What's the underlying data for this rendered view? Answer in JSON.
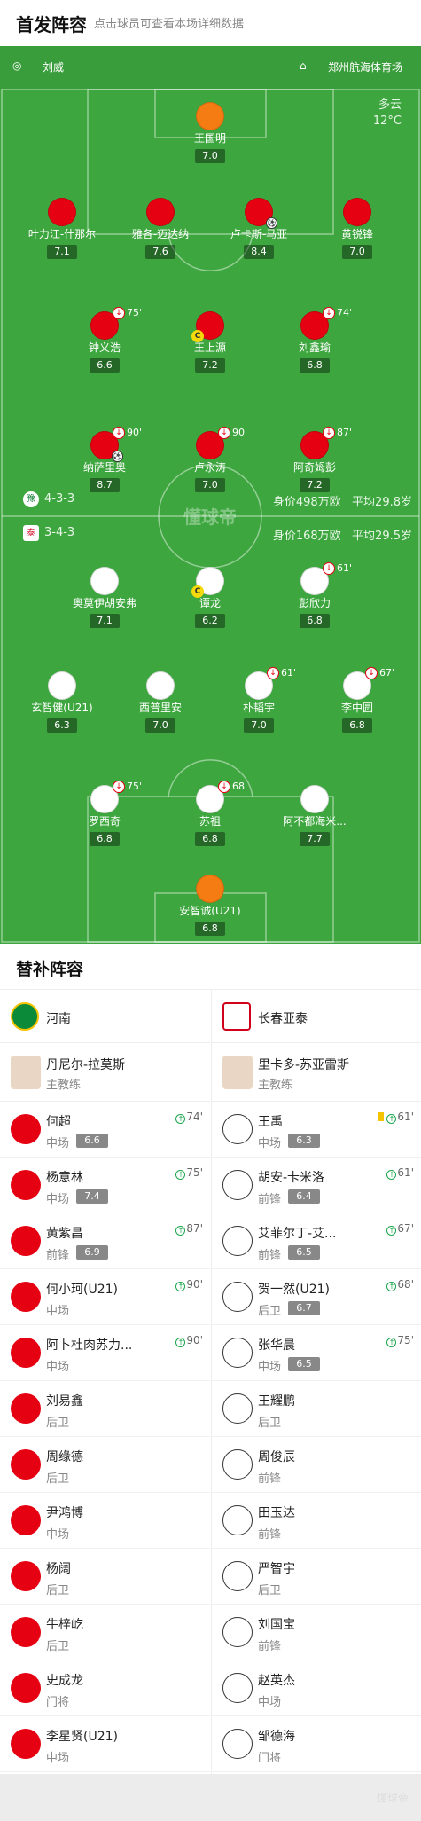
{
  "header": {
    "title": "首发阵容",
    "hint": "点击球员可查看本场详细数据"
  },
  "match": {
    "referee": "刘威",
    "venue": "郑州航海体育场",
    "weather": "多云",
    "temperature": "12°C",
    "watermark": "懂球帝"
  },
  "home": {
    "formation": "4-3-3",
    "value": "身价498万欧",
    "avg_age": "平均29.8岁",
    "players": [
      {
        "name": "王国明",
        "rating": "7.0",
        "color": "orange"
      },
      {
        "name": "叶力江-什那尔",
        "rating": "7.1",
        "color": "red"
      },
      {
        "name": "雅各-迈达纳",
        "rating": "7.6",
        "color": "red"
      },
      {
        "name": "卢卡斯-马亚",
        "rating": "8.4",
        "color": "red"
      },
      {
        "name": "黄锐锋",
        "rating": "7.0",
        "color": "red"
      },
      {
        "name": "钟义浩",
        "rating": "6.6",
        "color": "red",
        "off": "75'"
      },
      {
        "name": "王上源",
        "rating": "7.2",
        "color": "red",
        "captain": "C"
      },
      {
        "name": "刘鑫瑜",
        "rating": "6.8",
        "color": "red",
        "off": "74'"
      },
      {
        "name": "纳萨里奥",
        "rating": "8.7",
        "color": "red",
        "off": "90'"
      },
      {
        "name": "卢永涛",
        "rating": "7.0",
        "color": "red",
        "off": "90'"
      },
      {
        "name": "阿奇姆彭",
        "rating": "7.2",
        "color": "red",
        "off": "87'"
      }
    ]
  },
  "away": {
    "formation": "3-4-3",
    "value": "身价168万欧",
    "avg_age": "平均29.5岁",
    "players": [
      {
        "name": "奥莫伊胡安弗",
        "rating": "7.1",
        "color": "white"
      },
      {
        "name": "谭龙",
        "rating": "6.2",
        "color": "white",
        "captain": "C"
      },
      {
        "name": "彭欣力",
        "rating": "6.8",
        "color": "white",
        "off": "61'"
      },
      {
        "name": "玄智健(U21)",
        "rating": "6.3",
        "color": "white"
      },
      {
        "name": "西普里安",
        "rating": "7.0",
        "color": "white"
      },
      {
        "name": "朴韬宇",
        "rating": "7.0",
        "color": "white",
        "off": "61'"
      },
      {
        "name": "李中圆",
        "rating": "6.8",
        "color": "white",
        "off": "67'"
      },
      {
        "name": "罗西奇",
        "rating": "6.8",
        "color": "white",
        "off": "75'"
      },
      {
        "name": "苏祖",
        "rating": "6.8",
        "color": "white",
        "off": "68'"
      },
      {
        "name": "阿不都海米...",
        "rating": "7.7",
        "color": "white"
      },
      {
        "name": "安智诚(U21)",
        "rating": "6.8",
        "color": "orange"
      }
    ]
  },
  "subs": {
    "title": "替补阵容",
    "home_team": "河南",
    "away_team": "长春亚泰",
    "home_coach": {
      "name": "丹尼尔-拉莫斯",
      "role": "主教练"
    },
    "away_coach": {
      "name": "里卡多-苏亚雷斯",
      "role": "主教练"
    },
    "home": [
      {
        "name": "何超",
        "pos": "中场",
        "rating": "6.6",
        "min": "74'"
      },
      {
        "name": "杨意林",
        "pos": "中场",
        "rating": "7.4",
        "min": "75'"
      },
      {
        "name": "黄紫昌",
        "pos": "前锋",
        "rating": "6.9",
        "min": "87'"
      },
      {
        "name": "何小珂(U21)",
        "pos": "中场",
        "rating": "",
        "min": "90'"
      },
      {
        "name": "阿卜杜肉苏力...",
        "pos": "中场",
        "rating": "",
        "min": "90'"
      },
      {
        "name": "刘易鑫",
        "pos": "后卫",
        "rating": "",
        "min": ""
      },
      {
        "name": "周缘德",
        "pos": "后卫",
        "rating": "",
        "min": ""
      },
      {
        "name": "尹鸿博",
        "pos": "中场",
        "rating": "",
        "min": ""
      },
      {
        "name": "杨阔",
        "pos": "后卫",
        "rating": "",
        "min": ""
      },
      {
        "name": "牛梓屹",
        "pos": "后卫",
        "rating": "",
        "min": ""
      },
      {
        "name": "史成龙",
        "pos": "门将",
        "rating": "",
        "min": ""
      },
      {
        "name": "李星贤(U21)",
        "pos": "中场",
        "rating": "",
        "min": ""
      }
    ],
    "away": [
      {
        "name": "王禹",
        "pos": "中场",
        "rating": "6.3",
        "min": "61'",
        "yellow": true
      },
      {
        "name": "胡安-卡米洛",
        "pos": "前锋",
        "rating": "6.4",
        "min": "61'"
      },
      {
        "name": "艾菲尔丁-艾...",
        "pos": "前锋",
        "rating": "6.5",
        "min": "67'"
      },
      {
        "name": "贺一然(U21)",
        "pos": "后卫",
        "rating": "6.7",
        "min": "68'"
      },
      {
        "name": "张华晨",
        "pos": "中场",
        "rating": "6.5",
        "min": "75'"
      },
      {
        "name": "王耀鹏",
        "pos": "后卫",
        "rating": "",
        "min": ""
      },
      {
        "name": "周俊辰",
        "pos": "前锋",
        "rating": "",
        "min": ""
      },
      {
        "name": "田玉达",
        "pos": "前锋",
        "rating": "",
        "min": ""
      },
      {
        "name": "严智宇",
        "pos": "后卫",
        "rating": "",
        "min": ""
      },
      {
        "name": "刘国宝",
        "pos": "前锋",
        "rating": "",
        "min": ""
      },
      {
        "name": "赵英杰",
        "pos": "中场",
        "rating": "",
        "min": ""
      },
      {
        "name": "邹德海",
        "pos": "门将",
        "rating": "",
        "min": ""
      }
    ]
  },
  "colors": {
    "pitch": "#3da63e",
    "home": "#e50012",
    "keeper": "#f57b13",
    "away": "#ffffff"
  }
}
